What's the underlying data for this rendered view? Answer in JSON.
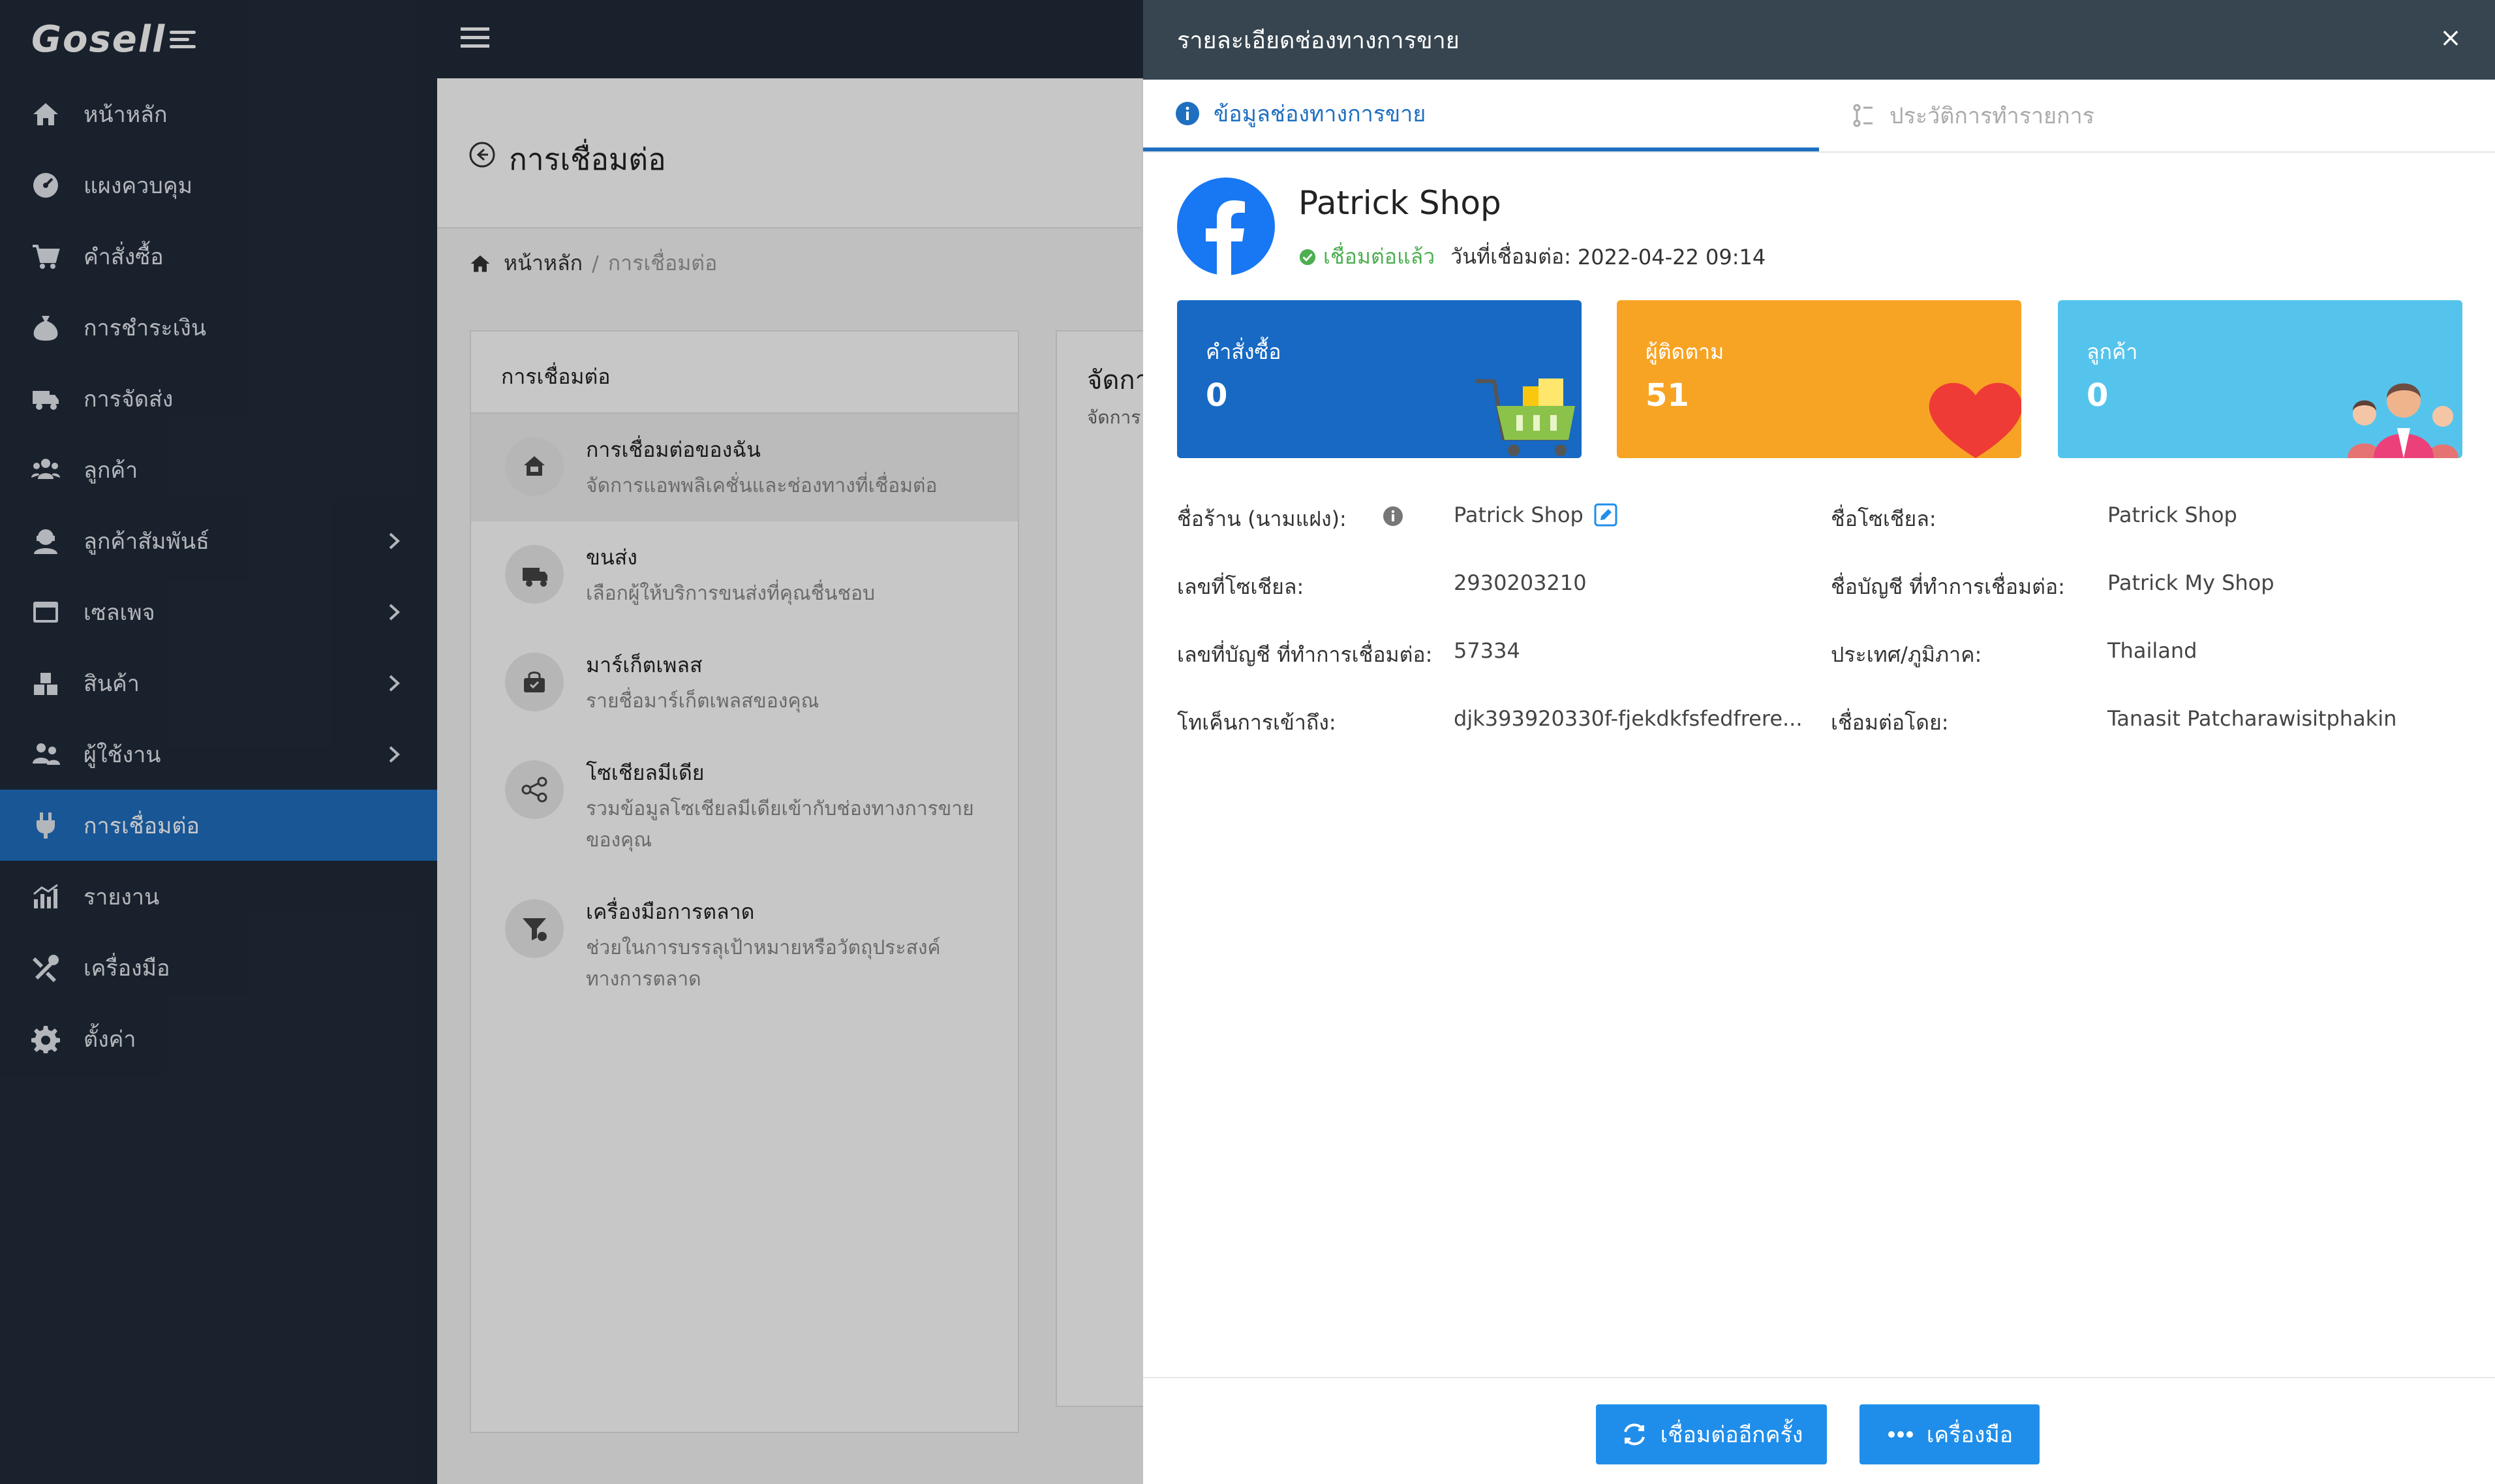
{
  "app": {
    "logo_text": "Gosell"
  },
  "sidebar": {
    "items": [
      {
        "label": "หน้าหลัก",
        "icon": "home-icon",
        "chevron": false,
        "active": false
      },
      {
        "label": "แผงควบคุม",
        "icon": "dashboard-icon",
        "chevron": false,
        "active": false
      },
      {
        "label": "คำสั่งซื้อ",
        "icon": "cart-icon",
        "chevron": false,
        "active": false
      },
      {
        "label": "การชำระเงิน",
        "icon": "money-bag-icon",
        "chevron": false,
        "active": false
      },
      {
        "label": "การจัดส่ง",
        "icon": "truck-icon",
        "chevron": false,
        "active": false
      },
      {
        "label": "ลูกค้า",
        "icon": "users-icon",
        "chevron": false,
        "active": false
      },
      {
        "label": "ลูกค้าสัมพันธ์",
        "icon": "crm-icon",
        "chevron": true,
        "active": false
      },
      {
        "label": "เซลเพจ",
        "icon": "window-icon",
        "chevron": true,
        "active": false
      },
      {
        "label": "สินค้า",
        "icon": "boxes-icon",
        "chevron": true,
        "active": false
      },
      {
        "label": "ผู้ใช้งาน",
        "icon": "user-group-icon",
        "chevron": true,
        "active": false
      },
      {
        "label": "การเชื่อมต่อ",
        "icon": "plug-icon",
        "chevron": false,
        "active": true
      },
      {
        "label": "รายงาน",
        "icon": "chart-icon",
        "chevron": false,
        "active": false
      },
      {
        "label": "เครื่องมือ",
        "icon": "tools-icon",
        "chevron": false,
        "active": false
      },
      {
        "label": "ตั้งค่า",
        "icon": "gear-icon",
        "chevron": false,
        "active": false
      }
    ]
  },
  "page": {
    "title": "การเชื่อมต่อ",
    "breadcrumb": {
      "home": "หน้าหลัก",
      "separator": "/",
      "current": "การเชื่อมต่อ"
    },
    "panel_title": "การเชื่อมต่อ",
    "connections": [
      {
        "title": "การเชื่อมต่อของฉัน",
        "desc": "จัดการแอพพลิเคชั่นและช่องทางที่เชื่อมต่อ",
        "icon": "store-icon"
      },
      {
        "title": "ขนส่ง",
        "desc": "เลือกผู้ให้บริการขนส่งที่คุณชื่นชอบ",
        "icon": "truck-icon"
      },
      {
        "title": "มาร์เก็ตเพลส",
        "desc": "รายชื่อมาร์เก็ตเพลสของคุณ",
        "icon": "bag-icon"
      },
      {
        "title": "โซเชียลมีเดีย",
        "desc": "รวมข้อมูลโซเชียลมีเดียเข้ากับช่องทางการขายของคุณ",
        "icon": "share-icon"
      },
      {
        "title": "เครื่องมือการตลาด",
        "desc": "ช่วยในการบรรลุเป้าหมายหรือวัตถุประสงค์ทางการตลาด",
        "icon": "funnel-icon"
      }
    ],
    "right_panel_title": "จัดกา",
    "right_panel_sub": "จัดการ"
  },
  "drawer": {
    "title": "รายละเอียดช่องทางการขาย",
    "close": "×",
    "tabs": [
      {
        "label": "ข้อมูลช่องทางการขาย",
        "active": true
      },
      {
        "label": "ประวัติการทำรายการ",
        "active": false
      }
    ],
    "shop": {
      "name": "Patrick Shop",
      "status": "เชื่อมต่อแล้ว",
      "date_label": "วันที่เชื่อมต่อ:",
      "date": "2022-04-22 09:14"
    },
    "stats": {
      "orders": {
        "label": "คำสั่งซื้อ",
        "value": "0",
        "color": "#1769c4"
      },
      "followers": {
        "label": "ผู้ติดตาม",
        "value": "51",
        "color": "#f7a424"
      },
      "customers": {
        "label": "ลูกค้า",
        "value": "0",
        "color": "#55c4ec"
      }
    },
    "info": {
      "shop_name_label": "ชื่อร้าน (นามแฝง):",
      "shop_name_value": "Patrick Shop",
      "social_name_label": "ชื่อโซเชียล:",
      "social_name_value": "Patrick Shop",
      "social_id_label": "เลขที่โซเชียล:",
      "social_id_value": "2930203210",
      "account_name_label": "ชื่อบัญชี ที่ทำการเชื่อมต่อ:",
      "account_name_value": "Patrick My Shop",
      "account_id_label": "เลขที่บัญชี ที่ทำการเชื่อมต่อ:",
      "account_id_value": "57334",
      "country_label": "ประเทศ/ภูมิภาค:",
      "country_value": "Thailand",
      "token_label": "โทเค็นการเข้าถึง:",
      "token_value": "djk393920330f-fjekdkfsfedfrere...",
      "connected_by_label": "เชื่อมต่อโดย:",
      "connected_by_value": "Tanasit Patcharawisitphakin"
    },
    "buttons": {
      "reconnect": "เชื่อมต่ออีกครั้ง",
      "tools": "เครื่องมือ"
    }
  }
}
